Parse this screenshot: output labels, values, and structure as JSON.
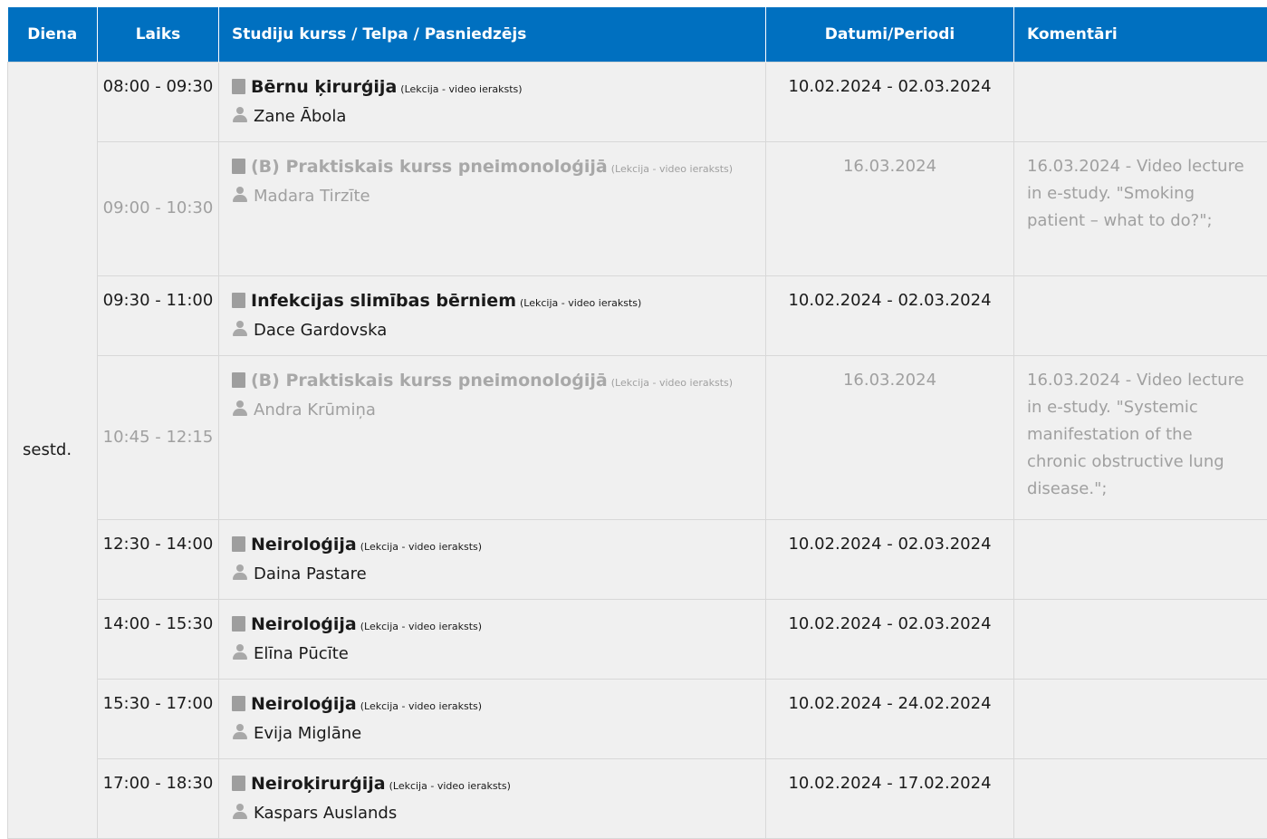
{
  "header": {
    "day": "Diena",
    "time": "Laiks",
    "course": "Studiju kurss / Telpa / Pasniedzējs",
    "dates": "Datumi/Periodi",
    "comments": "Komentāri"
  },
  "day_label": "sestd.",
  "rows": [
    {
      "time": "08:00 - 09:30",
      "course": "Bērnu ķirurģija",
      "type": "(Lekcija - video ieraksts)",
      "lecturer": "Zane Ābola",
      "dates": "10.02.2024 - 02.03.2024",
      "comment": ""
    },
    {
      "time": "09:00 - 10:30",
      "course": "(B) Praktiskais kurss pneimonoloģijā",
      "type": "(Lekcija - video ieraksts)",
      "lecturer": "Madara Tirzīte",
      "dates": "16.03.2024",
      "comment": "16.03.2024 - Video lecture in e-study. \"Smoking patient – what to do?\";"
    },
    {
      "time": "09:30 - 11:00",
      "course": "Infekcijas slimības bērniem",
      "type": "(Lekcija - video ieraksts)",
      "lecturer": "Dace Gardovska",
      "dates": "10.02.2024 - 02.03.2024",
      "comment": ""
    },
    {
      "time": "10:45 - 12:15",
      "course": "(B) Praktiskais kurss pneimonoloģijā",
      "type": "(Lekcija - video ieraksts)",
      "lecturer": "Andra Krūmiņa",
      "dates": "16.03.2024",
      "comment": "16.03.2024 - Video lecture in e-study. \"Systemic manifestation of the chronic obstructive lung disease.\";"
    },
    {
      "time": "12:30 - 14:00",
      "course": "Neiroloģija",
      "type": "(Lekcija - video ieraksts)",
      "lecturer": "Daina Pastare",
      "dates": "10.02.2024 - 02.03.2024",
      "comment": ""
    },
    {
      "time": "14:00 - 15:30",
      "course": "Neiroloģija",
      "type": "(Lekcija - video ieraksts)",
      "lecturer": "Elīna Pūcīte",
      "dates": "10.02.2024 - 02.03.2024",
      "comment": ""
    },
    {
      "time": "15:30 - 17:00",
      "course": "Neiroloģija",
      "type": "(Lekcija - video ieraksts)",
      "lecturer": "Evija Miglāne",
      "dates": "10.02.2024 - 24.02.2024",
      "comment": ""
    },
    {
      "time": "17:00 - 18:30",
      "course": "Neiroķirurģija",
      "type": "(Lekcija - video ieraksts)",
      "lecturer": "Kaspars Auslands",
      "dates": "10.02.2024 - 17.02.2024",
      "comment": ""
    }
  ],
  "colors": {
    "header_bg": "#0070c0",
    "row_bg": "#f0f0f0",
    "dim_text": "#a0a0a0"
  },
  "icons": {
    "course": "book-icon",
    "lecturer": "person-icon"
  }
}
